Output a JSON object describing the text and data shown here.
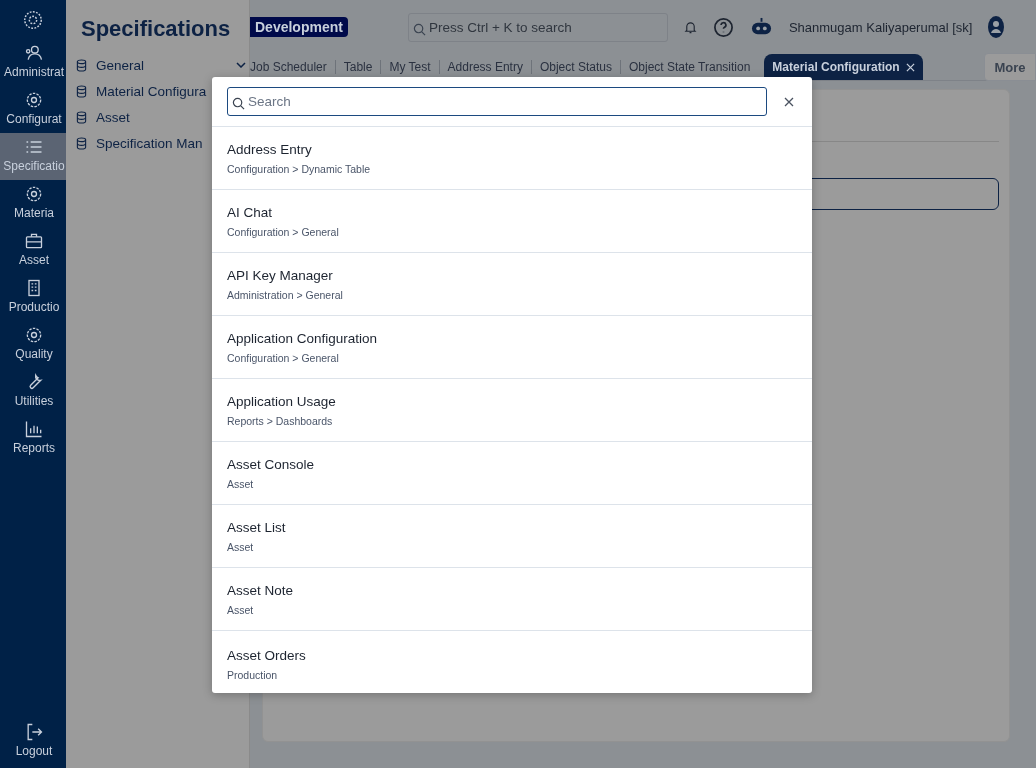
{
  "rail": {
    "items": [
      {
        "label": "Administrat",
        "selected": false
      },
      {
        "label": "Configurat",
        "selected": false
      },
      {
        "label": "Specificatio",
        "selected": true
      },
      {
        "label": "Materia",
        "selected": false
      },
      {
        "label": "Asset",
        "selected": false
      },
      {
        "label": "Productio",
        "selected": false
      },
      {
        "label": "Quality",
        "selected": false
      },
      {
        "label": "Utilities",
        "selected": false
      },
      {
        "label": "Reports",
        "selected": false
      }
    ],
    "logout": "Logout"
  },
  "sidebar": {
    "title": "Specifications",
    "items": [
      {
        "label": "General",
        "kind": "group"
      },
      {
        "label": "Material Configura",
        "kind": "item"
      },
      {
        "label": "Asset",
        "kind": "item"
      },
      {
        "label": "Specification Man",
        "kind": "item"
      }
    ]
  },
  "header": {
    "environment": "Development",
    "search_placeholder": "Press Ctrl + K to search",
    "user": "Shanmugam Kaliyaperumal [sk]"
  },
  "tabs": [
    {
      "label": "Job Scheduler",
      "selected": false
    },
    {
      "label": "Table",
      "selected": false
    },
    {
      "label": "My Test",
      "selected": false
    },
    {
      "label": "Address Entry",
      "selected": false
    },
    {
      "label": "Object Status",
      "selected": false
    },
    {
      "label": "Object State Transition",
      "selected": false
    },
    {
      "label": "Material Configuration",
      "selected": true
    }
  ],
  "more": "More",
  "modal": {
    "search_placeholder": "Search",
    "results": [
      {
        "title": "Address Entry",
        "path": "Configuration > Dynamic Table"
      },
      {
        "title": "AI Chat",
        "path": "Configuration > General"
      },
      {
        "title": "API Key Manager",
        "path": "Administration > General"
      },
      {
        "title": "Application Configuration",
        "path": "Configuration > General"
      },
      {
        "title": "Application Usage",
        "path": "Reports > Dashboards"
      },
      {
        "title": "Asset Console",
        "path": "Asset"
      },
      {
        "title": "Asset List",
        "path": "Asset"
      },
      {
        "title": "Asset Note",
        "path": "Asset"
      },
      {
        "title": "Asset Orders",
        "path": "Production"
      }
    ]
  }
}
